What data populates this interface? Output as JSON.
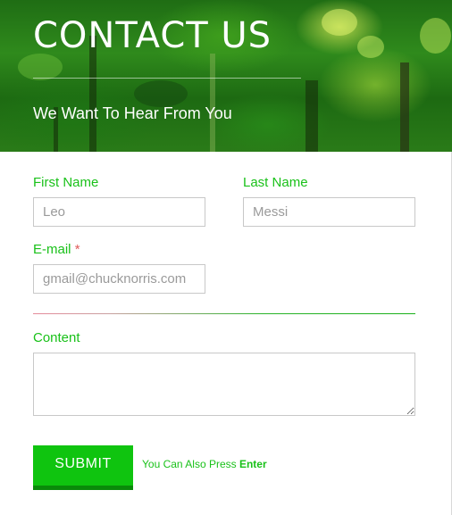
{
  "header": {
    "title": "CONTACT US",
    "subtitle": "We Want To Hear From You"
  },
  "form": {
    "first_name": {
      "label": "First Name",
      "placeholder": "Leo"
    },
    "last_name": {
      "label": "Last Name",
      "placeholder": "Messi"
    },
    "email": {
      "label": "E-mail",
      "required_mark": "*",
      "placeholder": "gmail@chucknorris.com"
    },
    "content": {
      "label": "Content",
      "value": ""
    },
    "submit_label": "SUBMIT",
    "hint_prefix": "You Can Also Press",
    "hint_key": "Enter"
  },
  "colors": {
    "accent": "#19c119",
    "submit_bg": "#0fc40f",
    "submit_shadow": "#098a09",
    "required": "#e05a5a"
  }
}
